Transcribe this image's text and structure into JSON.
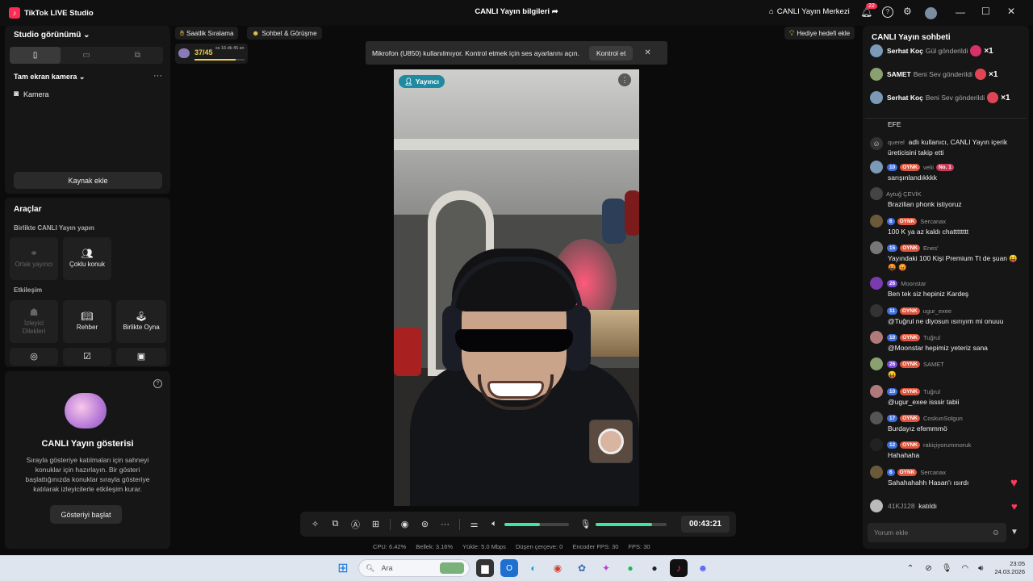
{
  "window": {
    "app_title": "TikTok LIVE Studio",
    "center_title": "CANLI Yayın bilgileri",
    "live_center": "CANLI Yayın Merkezi",
    "notif_count": "22"
  },
  "studio": {
    "title": "Studio görünümü",
    "scene_title": "Tam ekran kamera",
    "source_camera": "Kamera",
    "add_source": "Kaynak ekle"
  },
  "tools": {
    "title": "Araçlar",
    "together_title": "Birlikte CANLI Yayın yapın",
    "cohost": "Ortak yayıncı",
    "multiguest": "Çoklu konuk",
    "interaction_title": "Etkileşim",
    "viewer_requests": "İzleyici Dilekleri",
    "guide": "Rehber",
    "play_together": "Birlikte Oyna"
  },
  "show": {
    "title": "CANLI Yayın gösterisi",
    "description": "Sırayla gösteriye katılmaları için sahneyi konuklar için hazırlayın. Bir gösteri başlattığınızda konuklar sırayla gösteriye katılarak izleyicilerle etkileşim kurar.",
    "start_button": "Gösteriyi başlat"
  },
  "top_chips": {
    "hourly_ranking": "Saatlik Sıralama",
    "chat_meet": "Sohbet & Görüşme",
    "gift_goal": "Hediye hedefi ekle"
  },
  "goal": {
    "progress_text": "37/45",
    "time_left": "ss 16 dk 45 sn",
    "progress": 0.82
  },
  "banner": {
    "text": "Mikrofon (U850) kullanılmıyor. Kontrol etmek için ses ayarlarını açın.",
    "button": "Kontrol et"
  },
  "video": {
    "badge": "Yayıncı"
  },
  "controls": {
    "timer": "00:43:21",
    "speaker_level": 0.55,
    "mic_level": 0.8
  },
  "stats": {
    "cpu": "CPU:  6.42%",
    "memory": "Bellek:  3.16%",
    "upload": "Yükle:  5.0 Mbps",
    "dropped": "Düşen çerçeve:  0",
    "encoder_fps": "Encoder FPS:  30",
    "fps": "FPS:  30"
  },
  "chat": {
    "title": "CANLI Yayın sohbeti",
    "gifts": [
      {
        "name": "Serhat Koç",
        "action": "Gül gönderildi",
        "count": "×1"
      },
      {
        "name": "SAMET",
        "action": "Beni Sev gönderildi",
        "count": "×1"
      },
      {
        "name": "Serhat Koç",
        "action": "Beni Sev gönderildi",
        "count": "×1"
      }
    ],
    "efe": "EFE",
    "follow": {
      "user": "querel",
      "text": "adlı kullanıcı, CANLI Yayın içerik üreticisini takip etti"
    },
    "messages": [
      {
        "level": "10",
        "tag": "OYNK",
        "user": "velii",
        "extra": "No. 1",
        "text": "sarışınlandıkkkk"
      },
      {
        "level": "",
        "tag": "",
        "user": "Aytuğ ÇEVİK",
        "extra": "",
        "text": "Brazilian phonk istiyoruz"
      },
      {
        "level": "6",
        "tag": "OYNK",
        "user": "Sercanax",
        "extra": "",
        "text": "100 K ya az kaldı chatttttttt"
      },
      {
        "level": "15",
        "tag": "OYNK",
        "user": "Enes'",
        "extra": "",
        "text": "Yayındaki 100 Kişi Premium Tt de şuan 😝 🤬 😡"
      },
      {
        "level": "26",
        "tag": "",
        "user": "Moonstar",
        "extra": "",
        "text": "Ben tek siz hepiniz Kardeş"
      },
      {
        "level": "11",
        "tag": "OYNK",
        "user": "ugur_exee",
        "extra": "",
        "text": "@Tuğrul ne diyosun ısırıyım mi onuuu"
      },
      {
        "level": "10",
        "tag": "OYNK",
        "user": "Tuğrul",
        "extra": "",
        "text": "@Moonstar hepimiz yeteriz sana"
      },
      {
        "level": "26",
        "tag": "OYNK",
        "user": "SAMET",
        "extra": "",
        "text": "😝"
      },
      {
        "level": "10",
        "tag": "OYNK",
        "user": "Tuğrul",
        "extra": "",
        "text": "@ugur_exee isssir tabii"
      },
      {
        "level": "17",
        "tag": "OYNK",
        "user": "CoskunSolgun",
        "extra": "",
        "text": "Burdayız efemmmö"
      },
      {
        "level": "12",
        "tag": "OYNK",
        "user": "rakiçiyorummoruk",
        "extra": "",
        "text": "Hahahaha"
      },
      {
        "level": "6",
        "tag": "OYNK",
        "user": "Sercanax",
        "extra": "",
        "text": "Sahahahahh Hasan'ı ısırdı"
      }
    ],
    "joined": {
      "user": "41KJ128",
      "text": "katıldı"
    },
    "input_placeholder": "Yorum ekle"
  },
  "taskbar": {
    "search": "Ara",
    "time": "23:05",
    "date": "24.03.2026"
  }
}
